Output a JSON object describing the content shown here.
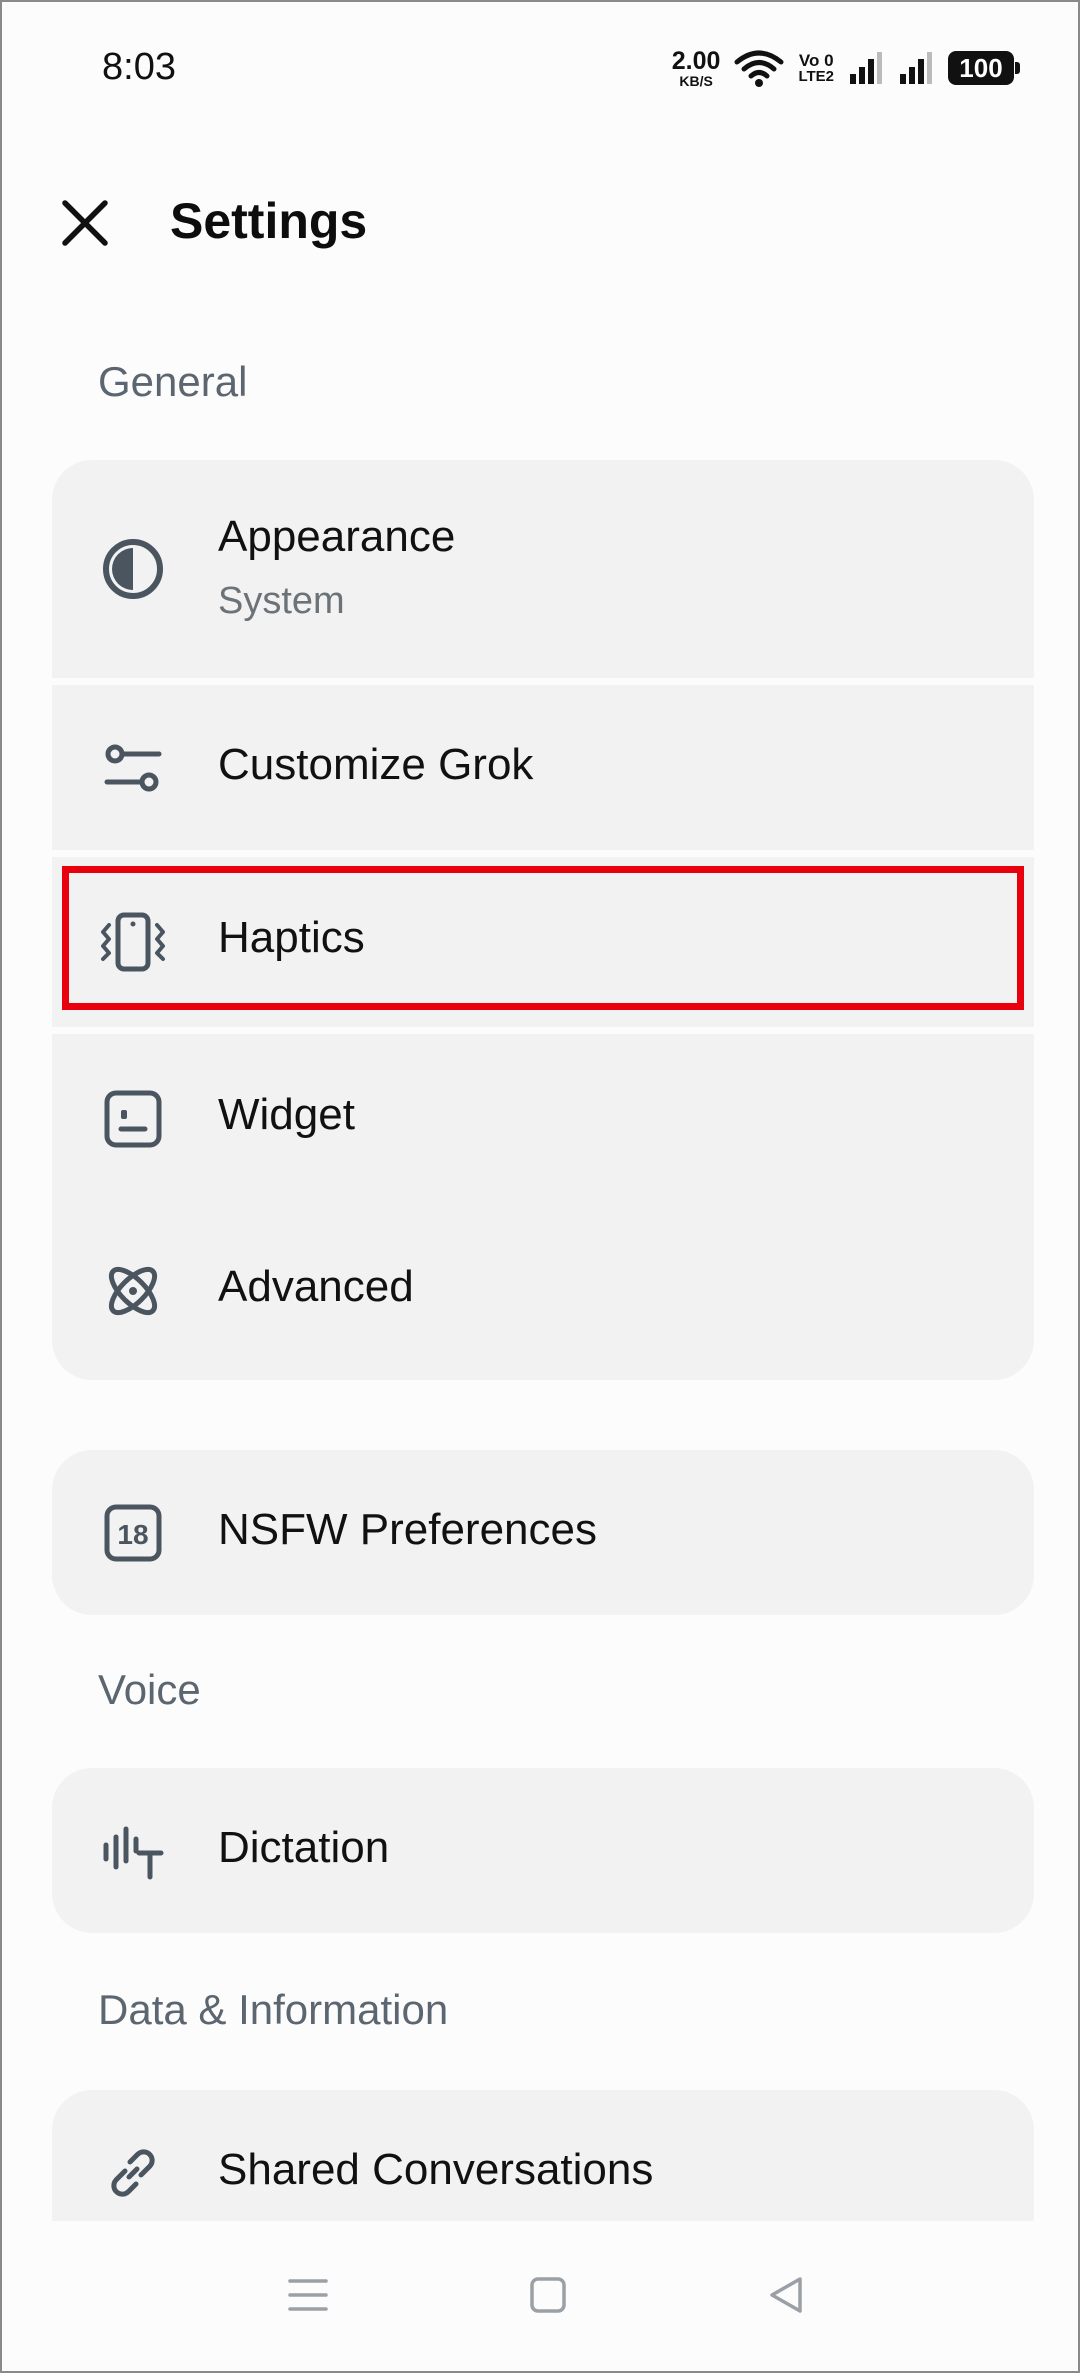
{
  "status_bar": {
    "time": "8:03",
    "net_speed_value": "2.00",
    "net_speed_unit": "KB/S",
    "volte_top": "Vo 0",
    "volte_bottom": "LTE2",
    "battery": "100"
  },
  "header": {
    "title": "Settings",
    "close_icon": "close-icon"
  },
  "sections": {
    "general": "General",
    "voice": "Voice",
    "data_info": "Data & Information"
  },
  "items": {
    "appearance": {
      "label": "Appearance",
      "value": "System",
      "icon": "contrast-icon"
    },
    "customize": {
      "label": "Customize Grok",
      "icon": "sliders-icon"
    },
    "haptics": {
      "label": "Haptics",
      "icon": "vibration-icon"
    },
    "widget": {
      "label": "Widget",
      "icon": "widget-icon"
    },
    "advanced": {
      "label": "Advanced",
      "icon": "atom-icon"
    },
    "nsfw": {
      "label": "NSFW Preferences",
      "icon": "age-18-icon"
    },
    "dictation": {
      "label": "Dictation",
      "icon": "dictation-icon"
    },
    "shared": {
      "label": "Shared Conversations",
      "icon": "link-icon"
    }
  },
  "colors": {
    "highlight": "#e8000f",
    "card_bg": "#f2f2f2",
    "section_label": "#5c6670"
  }
}
